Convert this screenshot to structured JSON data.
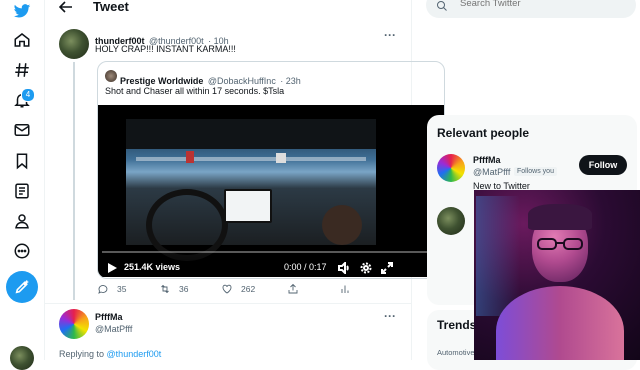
{
  "nav": {
    "icons": [
      "twitter-logo-icon",
      "home-icon",
      "explore-icon",
      "notifications-icon",
      "messages-icon",
      "bookmarks-icon",
      "lists-icon",
      "profile-icon",
      "more-icon",
      "compose-tweet-icon"
    ],
    "notifications_badge": "4",
    "brand_color": "#1d9bf0"
  },
  "header": {
    "title": "Tweet"
  },
  "tweet": {
    "name": "thunderf00t",
    "handle": "@thunderf00t",
    "time": "· 10h",
    "text": "HOLY CRAP!!! INSTANT KARMA!!!"
  },
  "quote": {
    "name": "Prestige Worldwide",
    "handle": "@DobackHuffInc",
    "time": "· 23h",
    "text": "Shot and Chaser all within 17 seconds. $Tsla",
    "video": {
      "views": "251.4K views",
      "time": "0:00 / 0:17",
      "progress": 0.0
    }
  },
  "actions": {
    "replies": "35",
    "retweets": "36",
    "likes": "262"
  },
  "reply": {
    "name": "PfffMa",
    "handle": "@MatPfff",
    "replying_prefix": "Replying to",
    "replying_to": "@thunderf00t"
  },
  "sidebar": {
    "search_placeholder": "Search Twitter",
    "relevant_title": "Relevant people",
    "person": {
      "name": "PfffMa",
      "handle": "@MatPfff",
      "follows_you": "Follows you",
      "bio": "New to Twitter",
      "follow_label": "Follow"
    },
    "trends_title": "Trends",
    "trend_category": "Automotive"
  }
}
